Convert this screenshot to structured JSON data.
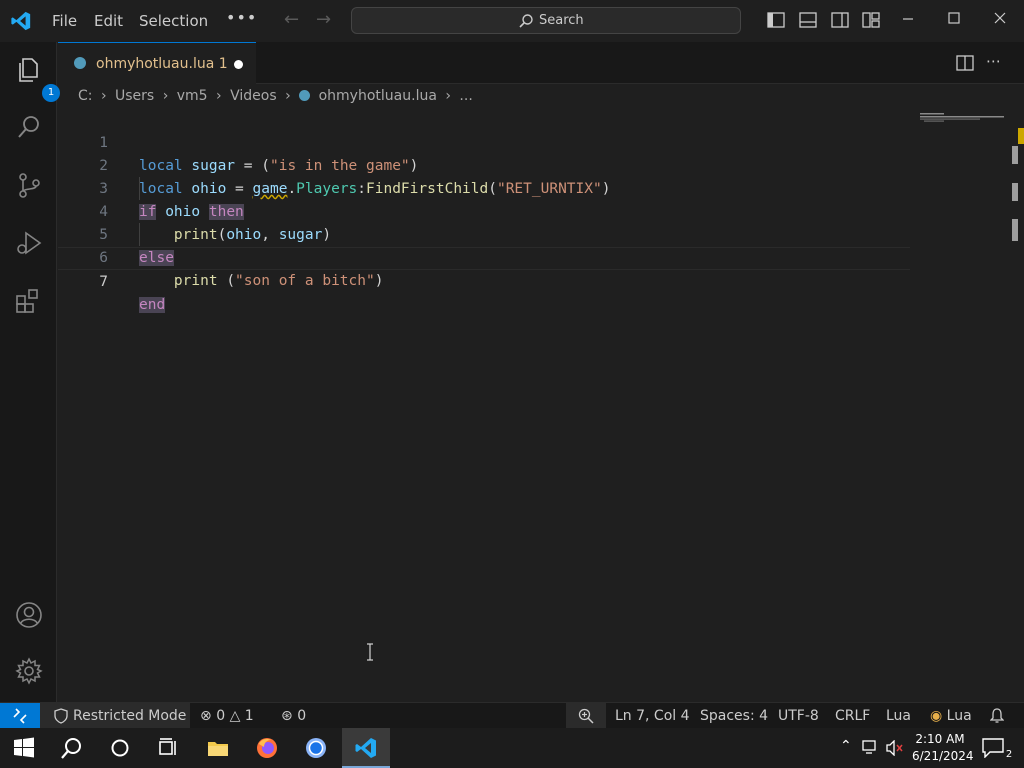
{
  "titlebar": {
    "menu": [
      "File",
      "Edit",
      "Selection"
    ],
    "more": "•••",
    "search_label": "Search"
  },
  "activitybar": {
    "explorer_badge": "1"
  },
  "tab": {
    "label": "ohmyhotluau.lua 1"
  },
  "breadcrumb": {
    "items": [
      "C:",
      "Users",
      "vm5",
      "Videos",
      "ohmyhotluau.lua",
      "..."
    ]
  },
  "editor": {
    "line_numbers": [
      "1",
      "2",
      "3",
      "4",
      "5",
      "6",
      "7"
    ],
    "active_line": 7
  },
  "statusbar": {
    "restricted": "Restricted Mode",
    "errors": "0",
    "warnings": "1",
    "ports": "0",
    "position": "Ln 7, Col 4",
    "spaces": "Spaces: 4",
    "encoding": "UTF-8",
    "eol": "CRLF",
    "language": "Lua",
    "language_ext": "Lua"
  },
  "taskbar": {
    "time": "2:10 AM",
    "date": "6/21/2024",
    "notifications": "2"
  },
  "colors": {
    "accent": "#0078d4",
    "modified_tab": "#e2c08d"
  }
}
